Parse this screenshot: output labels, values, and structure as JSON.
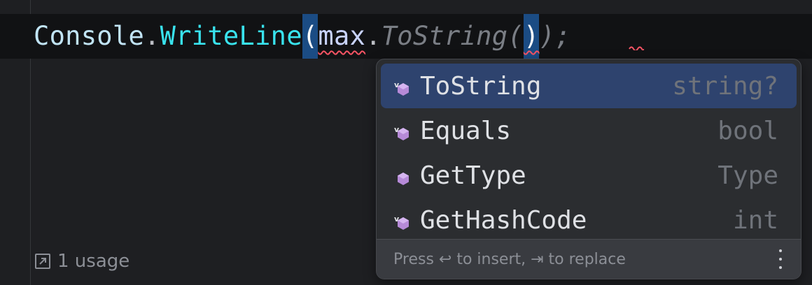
{
  "editor": {
    "code": {
      "class": "Console",
      "dot1": ".",
      "method": "WriteLine",
      "paren_open": "(",
      "variable": "max",
      "dot2": ".",
      "hint": "ToString(",
      "caret_paren": ")",
      "tail": ");"
    },
    "usages": "1 usage"
  },
  "completion": {
    "items": [
      {
        "name": "ToString",
        "type": "string?",
        "icon": "virtual-method-icon",
        "selected": true
      },
      {
        "name": "Equals",
        "type": "bool",
        "icon": "virtual-method-icon",
        "selected": false
      },
      {
        "name": "GetType",
        "type": "Type",
        "icon": "method-icon",
        "selected": false
      },
      {
        "name": "GetHashCode",
        "type": "int",
        "icon": "virtual-method-icon",
        "selected": false
      }
    ],
    "footer_hint": "Press ↩ to insert, ⇥ to replace"
  },
  "colors": {
    "background": "#1e1f22",
    "current_line": "#111214",
    "method": "#39e3ee",
    "selection": "#2e436e",
    "icon_purple": "#b68ad8",
    "error_squiggle": "#f75464"
  }
}
